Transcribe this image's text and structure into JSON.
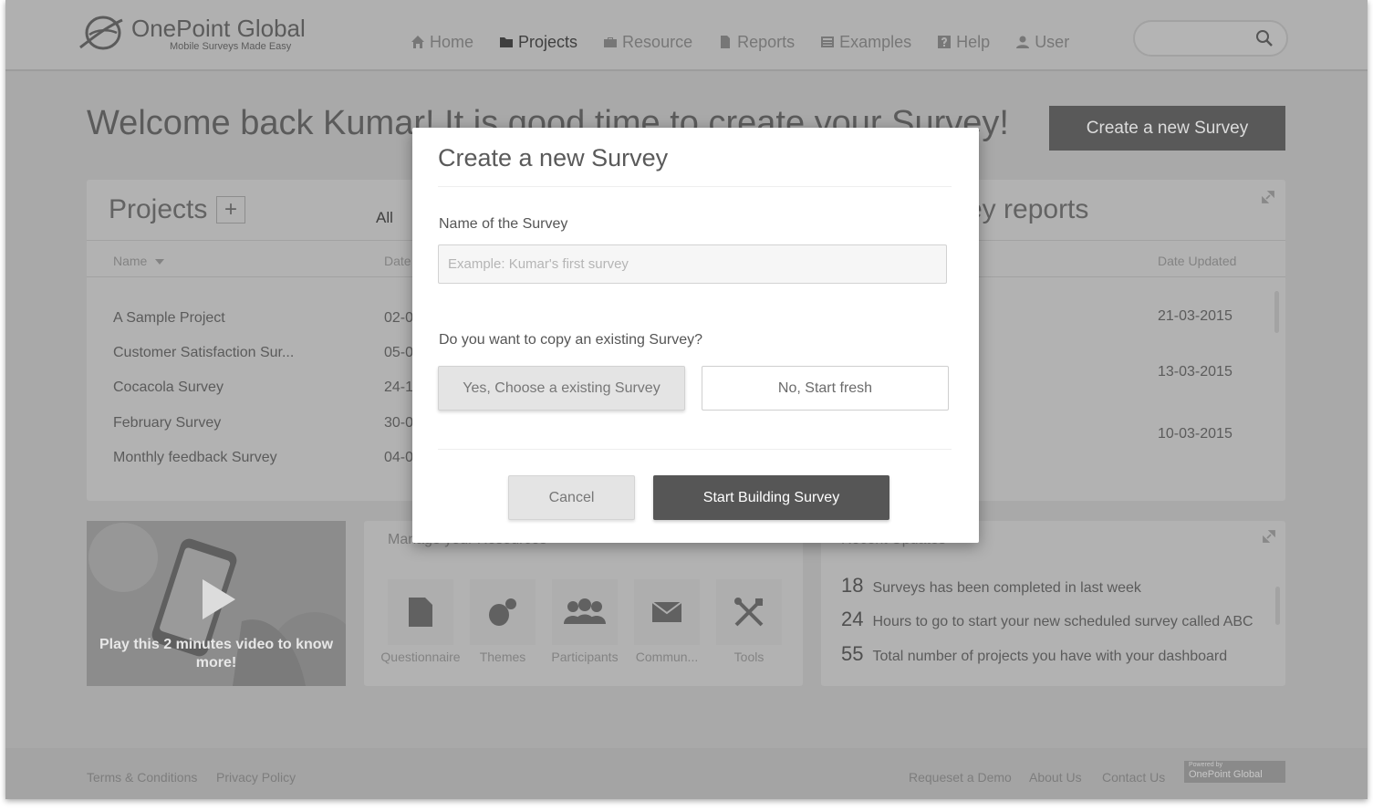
{
  "brand": {
    "name": "OnePoint Global",
    "tagline": "Mobile Surveys Made Easy"
  },
  "nav": [
    {
      "label": "Home",
      "icon": "home-icon"
    },
    {
      "label": "Projects",
      "icon": "folder-icon"
    },
    {
      "label": "Resource",
      "icon": "briefcase-icon"
    },
    {
      "label": "Reports",
      "icon": "document-icon"
    },
    {
      "label": "Examples",
      "icon": "list-icon"
    },
    {
      "label": "Help",
      "icon": "help-icon"
    },
    {
      "label": "User",
      "icon": "user-icon"
    }
  ],
  "welcome": "Welcome back Kumar! It is good time to create  your Survey!",
  "create_button": "Create a new Survey",
  "projects": {
    "title": "Projects",
    "add_label": "+",
    "filter": "All",
    "col_name": "Name",
    "col_date": "Date",
    "rows": [
      {
        "name": "A Sample Project",
        "date": "02-0"
      },
      {
        "name": "Customer Satisfaction Sur...",
        "date": "05-0"
      },
      {
        "name": "Cocacola Survey",
        "date": "24-1"
      },
      {
        "name": "February Survey",
        "date": "30-0"
      },
      {
        "name": "Monthly feedback Survey",
        "date": "04-0"
      }
    ]
  },
  "reports": {
    "title": "ey reports",
    "col_updated": "Date Updated",
    "rows": [
      {
        "date": "21-03-2015"
      },
      {
        "date": "13-03-2015"
      },
      {
        "date": "10-03-2015"
      }
    ]
  },
  "video": {
    "caption": "Play this 2 minutes video to know more!"
  },
  "resources": {
    "title": "Manage your Resources",
    "items": [
      {
        "label": "Questionnaire",
        "icon": "questionnaire-icon"
      },
      {
        "label": "Themes",
        "icon": "themes-icon"
      },
      {
        "label": "Participants",
        "icon": "participants-icon"
      },
      {
        "label": "Commun...",
        "icon": "envelope-icon"
      },
      {
        "label": "Tools",
        "icon": "tools-icon"
      }
    ]
  },
  "updates": {
    "title": "Recent Updates",
    "rows": [
      {
        "num": "18",
        "text": "Surveys has been completed in last week"
      },
      {
        "num": "24",
        "text": "Hours to go to start your new scheduled survey called ABC"
      },
      {
        "num": "55",
        "text": "Total number of projects you have with your dashboard"
      }
    ]
  },
  "footer": {
    "terms": "Terms & Conditions",
    "privacy": "Privacy Policy",
    "demo": "Requeset a Demo",
    "about": "About Us",
    "contact": "Contact Us",
    "powered_small": "Powered by",
    "powered_brand": "OnePoint Global"
  },
  "modal": {
    "title": "Create a new Survey",
    "name_label": "Name of the Survey",
    "name_placeholder": "Example: Kumar's first survey",
    "name_value": "",
    "copy_question": "Do you want to copy an existing Survey?",
    "yes_label": "Yes, Choose a existing Survey",
    "no_label": "No, Start fresh",
    "cancel_label": "Cancel",
    "start_label": "Start Building Survey"
  }
}
